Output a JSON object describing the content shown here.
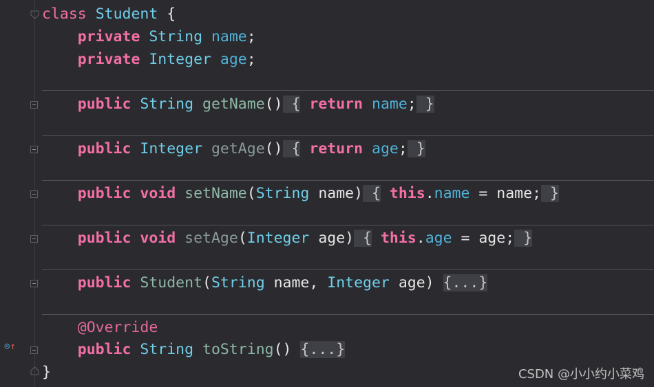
{
  "code": {
    "class_kw": "class",
    "class_name": "Student",
    "open_brace": " {",
    "close_brace": "}",
    "field_name": {
      "mod": "private",
      "type": "String",
      "name": "name",
      "end": ";"
    },
    "field_age": {
      "mod": "private",
      "type": "Integer",
      "name": "age",
      "end": ";"
    },
    "get_name": {
      "mod": "public",
      "type": "String",
      "method": "getName",
      "sig": "()",
      "fold_open": " {",
      "ret": "return",
      "val": "name",
      "semi": ";",
      "fold_close": " }"
    },
    "get_age": {
      "mod": "public",
      "type": "Integer",
      "method": "getAge",
      "sig": "()",
      "fold_open": " {",
      "ret": "return",
      "val": "age",
      "semi": ";",
      "fold_close": " }"
    },
    "set_name": {
      "mod": "public",
      "ret": "void",
      "method": "setName",
      "p_open": "(",
      "ptype": "String",
      "pname": " name",
      "p_close": ")",
      "fold_open": " {",
      "this": "this",
      "dot": ".",
      "field": "name",
      "assign": " = name",
      "semi": ";",
      "fold_close": " }"
    },
    "set_age": {
      "mod": "public",
      "ret": "void",
      "method": "setAge",
      "p_open": "(",
      "ptype": "Integer",
      "pname": " age",
      "p_close": ")",
      "fold_open": " {",
      "this": "this",
      "dot": ".",
      "field": "age",
      "assign": " = age",
      "semi": ";",
      "fold_close": " }"
    },
    "ctor": {
      "mod": "public",
      "method": "Student",
      "p_open": "(",
      "ptype1": "String",
      "pname1": " name",
      "comma": ", ",
      "ptype2": "Integer",
      "pname2": " age",
      "p_close": ") ",
      "folded": "{...}"
    },
    "to_string": {
      "anno": "@Override",
      "mod": "public",
      "type": "String",
      "method": "toString",
      "sig": "() ",
      "folded": "{...}"
    }
  },
  "gutter": {
    "override_icon": "override-icon",
    "up_arrow": "↑",
    "o_glyph": "⊙"
  },
  "watermark": "CSDN @小小约小菜鸡"
}
